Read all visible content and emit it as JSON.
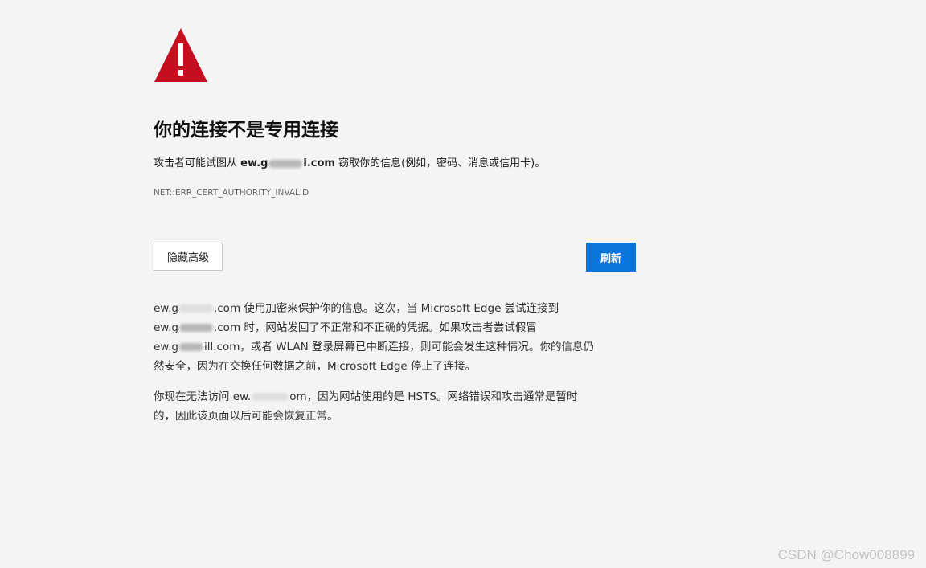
{
  "warning": {
    "icon": "warning-triangle-icon",
    "color": "#c50f1f"
  },
  "title": "你的连接不是专用连接",
  "description": {
    "prefix": "攻击者可能试图从 ",
    "domain_start": "ew.g",
    "domain_end": "l.com",
    "suffix": " 窃取你的信息(例如，密码、消息或信用卡)。"
  },
  "error_code": "NET::ERR_CERT_AUTHORITY_INVALID",
  "buttons": {
    "advanced_label": "隐藏高级",
    "refresh_label": "刷新",
    "refresh_color": "#0a74da"
  },
  "details": {
    "para1": {
      "l1_start": "ew.g",
      "l1_rest": ".com 使用加密来保护你的信息。这次，当 Microsoft Edge 尝试连接到",
      "l2_start": "ew.g",
      "l2_rest": ".com 时，网站发回了不正常和不正确的凭据。如果攻击者尝试假冒",
      "l3_start": "ew.g",
      "l3_mid": "ill",
      "l3_rest": ".com，或者 WLAN 登录屏幕已中断连接，则可能会发生这种情况。你的信息仍",
      "l4": "然安全，因为在交换任何数据之前，Microsoft Edge 停止了连接。"
    },
    "para2": {
      "l1_start": "你现在无法访问 ew.",
      "l1_rest": "om，因为网站使用的是 HSTS。网络错误和攻击通常是暂时",
      "l2": "的，因此该页面以后可能会恢复正常。"
    }
  },
  "watermark": "CSDN @Chow008899"
}
